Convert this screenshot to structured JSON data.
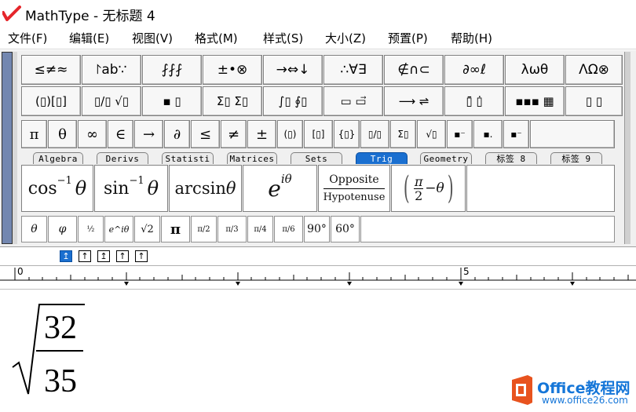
{
  "app": {
    "title": "MathType - 无标题 4"
  },
  "menu": [
    "文件(F)",
    "编辑(E)",
    "视图(V)",
    "格式(M)",
    "样式(S)",
    "大小(Z)",
    "预置(P)",
    "帮助(H)"
  ],
  "palette_row1": [
    "≤≠≈",
    "⨡ab∵",
    "⨏⨏⨏",
    "±•⊗",
    "→⇔↓",
    "∴∀∃",
    "∉∩⊂",
    "∂∞ℓ",
    "λωθ",
    "ΛΩ⊗"
  ],
  "palette_row2": [
    "(▯)[▯]",
    "▯/▯ √▯",
    "▪ ▯",
    "Σ▯ Σ▯",
    "∫▯ ∮▯",
    "▭ ▭⃗",
    "⟶ ⇌",
    "▯̄ ▯̇",
    "▪▪▪ ▦",
    "▯ ▯"
  ],
  "palette_row3": [
    "π",
    "θ",
    "∞",
    "∈",
    "→",
    "∂",
    "≤",
    "≠",
    "±",
    "(▯)",
    "[▯]",
    "{▯}",
    "▯/▯",
    "Σ▯",
    "√▯",
    "▪⁻",
    "▪.",
    "▪⁻"
  ],
  "tabs": [
    "Algebra",
    "Derivs",
    "Statisti",
    "Matrices",
    "Sets",
    "Trig",
    "Geometry",
    "标签 8",
    "标签 9"
  ],
  "trig_templates": {
    "cos_inv": "cos",
    "sin_inv": "sin",
    "exp_minus1": "−1",
    "theta": "θ",
    "arcsin": "arcsin",
    "exp_base": "e",
    "exp_power": "iθ",
    "opposite": "Opposite",
    "hypotenuse": "Hypotenuse",
    "pi_over_2": "π",
    "two": "2",
    "minus_theta": "−θ"
  },
  "small_row": [
    "θ",
    "φ",
    "½",
    "e^iθ",
    "√2",
    "π",
    "π/2",
    "π/3",
    "π/4",
    "π/6",
    "90°",
    "60°"
  ],
  "size_buttons": [
    "↥",
    "↑",
    "↥",
    "↑",
    "↑"
  ],
  "ruler": {
    "label_0": "0",
    "label_5": "5"
  },
  "equation": {
    "numerator": "32",
    "denominator": "35"
  },
  "watermark": {
    "brand": "Office教程网",
    "url": "www.office26.com"
  },
  "colors": {
    "accent": "#1a6fd0",
    "logo_red": "#e5262b",
    "watermark": "#1576d8",
    "strip": "#7387b0"
  }
}
